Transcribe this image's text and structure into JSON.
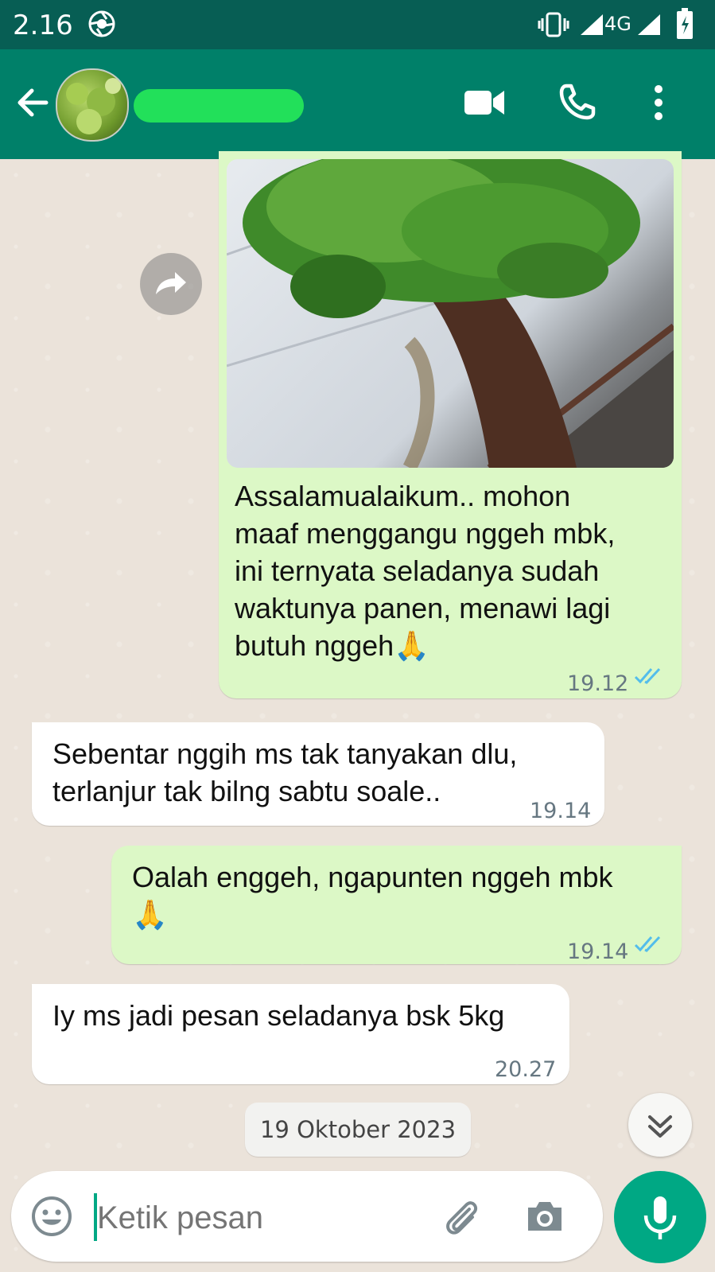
{
  "status_bar": {
    "time": "2.16",
    "network": "4G"
  },
  "header": {
    "back_icon": "arrow-left-icon",
    "menu_icon": "more-vertical-icon",
    "video_icon": "video-call-icon",
    "call_icon": "phone-icon"
  },
  "messages": [
    {
      "direction": "outgoing",
      "has_image": true,
      "text_lines": [
        "Assalamualaikum.. mohon",
        "maaf menggangu nggeh mbk,",
        "ini ternyata seladanya sudah",
        "waktunya panen, menawi lagi",
        "butuh nggeh"
      ],
      "emoji": "🙏",
      "time": "19.12",
      "status": "read"
    },
    {
      "direction": "incoming",
      "text_lines": [
        "Sebentar nggih ms tak tanyakan dlu,",
        "terlanjur tak bilng sabtu soale.."
      ],
      "time": "19.14"
    },
    {
      "direction": "outgoing",
      "text_lines": [
        "Oalah enggeh, ngapunten nggeh mbk"
      ],
      "emoji": "🙏",
      "time": "19.14",
      "status": "read"
    },
    {
      "direction": "incoming",
      "text_lines": [
        "Iy ms jadi pesan seladanya bsk 5kg"
      ],
      "time": "20.27"
    }
  ],
  "date_separator": "19 Oktober 2023",
  "composer": {
    "placeholder": "Ketik pesan",
    "emoji_icon": "emoji-icon",
    "attach_icon": "paperclip-icon",
    "camera_icon": "camera-icon",
    "mic_icon": "mic-icon"
  },
  "colors": {
    "header": "#008069",
    "statusbar": "#075e54",
    "outgoing_bubble": "#dcf8c6",
    "incoming_bubble": "#ffffff",
    "read_ticks": "#53bdeb",
    "mic_button": "#00a884"
  }
}
